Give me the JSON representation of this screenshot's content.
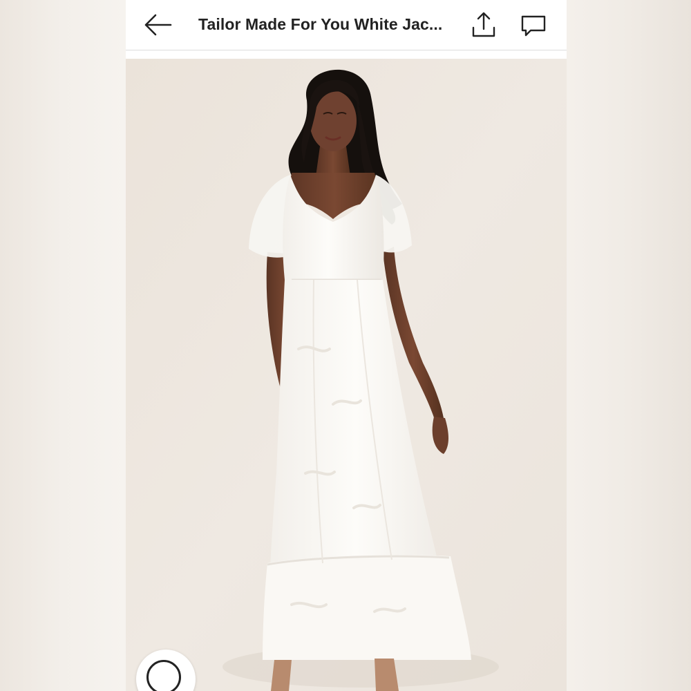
{
  "header": {
    "title": "Tailor Made For You White Jac...",
    "back_icon": "arrow-left-icon",
    "share_icon": "share-upload-icon",
    "comment_icon": "comment-bubble-icon"
  },
  "photo": {
    "subject": "product-photo",
    "background_color": "#ede6de",
    "dress_color": "#fbfaf7"
  },
  "capture_button_icon": "camera-shutter-icon"
}
